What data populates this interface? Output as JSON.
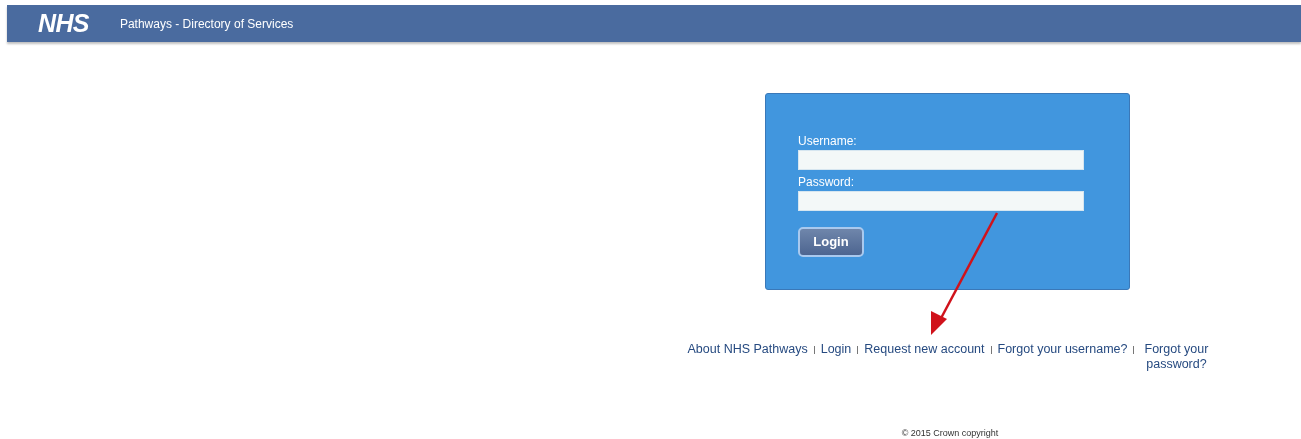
{
  "header": {
    "logo": "NHS",
    "title": "Pathways - Directory of Services"
  },
  "login_form": {
    "fields": [
      {
        "label": "Username:"
      },
      {
        "label": "Password:"
      }
    ],
    "button": "Login"
  },
  "footer_links": [
    "About NHS Pathways",
    "Login",
    "Request new account",
    "Forgot your username?",
    "Forgot your password?"
  ],
  "copyright": "© 2015 Crown copyright"
}
